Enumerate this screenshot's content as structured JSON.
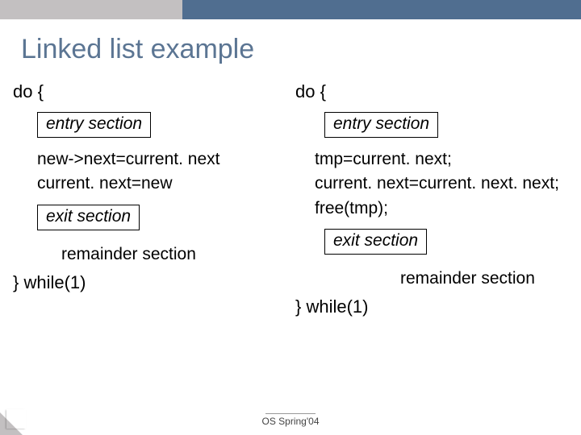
{
  "title": "Linked list example",
  "left": {
    "do_open": "do {",
    "entry": "entry section",
    "code": [
      "new->next=current. next",
      "current. next=new"
    ],
    "exit": "exit section",
    "remainder": "remainder section",
    "do_close": "} while(1)"
  },
  "right": {
    "do_open": "do {",
    "entry": "entry section",
    "code": [
      "tmp=current. next;",
      "current. next=current. next. next;",
      "free(tmp);"
    ],
    "exit": "exit section",
    "remainder": "remainder section",
    "do_close": "} while(1)"
  },
  "footer": "OS Spring'04"
}
